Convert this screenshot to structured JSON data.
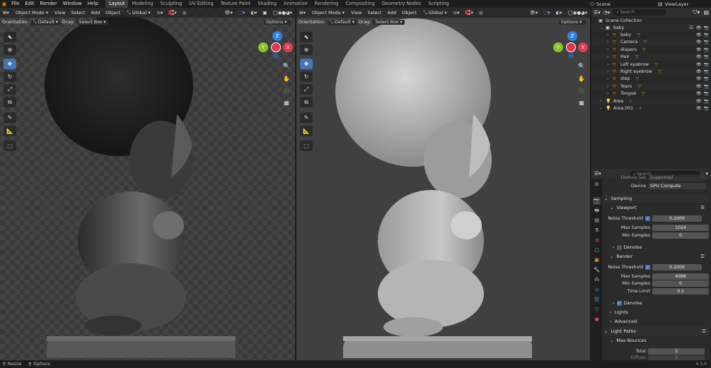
{
  "menu": [
    "File",
    "Edit",
    "Render",
    "Window",
    "Help"
  ],
  "workspaces": [
    "Layout",
    "Modeling",
    "Sculpting",
    "UV Editing",
    "Texture Paint",
    "Shading",
    "Animation",
    "Rendering",
    "Compositing",
    "Geometry Nodes",
    "Scripting"
  ],
  "active_workspace": "Layout",
  "scene_label": "Scene",
  "viewlayer_label": "ViewLayer",
  "viewport_left": {
    "mode": "Object Mode",
    "menus": [
      "View",
      "Select",
      "Add",
      "Object"
    ],
    "transform": "Global",
    "orientation_label": "Orientation:",
    "orientation_value": "Default",
    "drag_label": "Drag:",
    "drag_value": "Select Box",
    "options": "Options"
  },
  "viewport_right": {
    "mode": "Object Mode",
    "menus": [
      "View",
      "Select",
      "Add",
      "Object"
    ],
    "transform": "Global",
    "orientation_label": "Orientation:",
    "orientation_value": "Default",
    "drag_label": "Drag:",
    "drag_value": "Select Box",
    "options": "Options"
  },
  "gizmo": {
    "z": "Z",
    "y": "Y",
    "x": "X"
  },
  "outliner": {
    "search_placeholder": "Search",
    "root": "Scene Collection",
    "items": [
      {
        "name": "baby",
        "depth": 1
      },
      {
        "name": "baby",
        "depth": 2
      },
      {
        "name": "Camera",
        "depth": 2
      },
      {
        "name": "diapers",
        "depth": 2
      },
      {
        "name": "Hair",
        "depth": 2
      },
      {
        "name": "Left eyebrow",
        "depth": 2
      },
      {
        "name": "Right eyebrow",
        "depth": 2
      },
      {
        "name": "step",
        "depth": 2
      },
      {
        "name": "Tears",
        "depth": 2
      },
      {
        "name": "Tongue",
        "depth": 2
      },
      {
        "name": "Area",
        "depth": 1
      },
      {
        "name": "Area.001",
        "depth": 1
      }
    ]
  },
  "properties": {
    "search_placeholder": "Search",
    "device_label": "Device",
    "device_value": "GPU Compute",
    "cut_label": "Feature Set",
    "cut_value": "Supported",
    "sampling": "Sampling",
    "viewport": "Viewport",
    "vp_noise_label": "Noise Threshold",
    "vp_noise_value": "0.1000",
    "vp_max_label": "Max Samples",
    "vp_max_value": "1024",
    "vp_min_label": "Min Samples",
    "vp_min_value": "0",
    "vp_denoise": "Denoise",
    "render": "Render",
    "r_noise_label": "Noise Threshold",
    "r_noise_value": "0.1000",
    "r_max_label": "Max Samples",
    "r_max_value": "4096",
    "r_min_label": "Min Samples",
    "r_min_value": "0",
    "r_time_label": "Time Limit",
    "r_time_value": "0 s",
    "r_denoise": "Denoise",
    "lights": "Lights",
    "advanced": "Advanced",
    "light_paths": "Light Paths",
    "max_bounces": "Max Bounces",
    "total_label": "Total",
    "total_value": "1",
    "diffuse_label": "Diffuse",
    "diffuse_value": "1"
  },
  "status": {
    "resize": "Resize",
    "options": "Options",
    "version": "4.3.0"
  },
  "colors": {
    "accent": "#4772b3",
    "x_axis": "#e2394f",
    "y_axis": "#89c32b",
    "z_axis": "#2f82e0",
    "mesh_icon": "#f0973c",
    "check": "#4772b3"
  }
}
